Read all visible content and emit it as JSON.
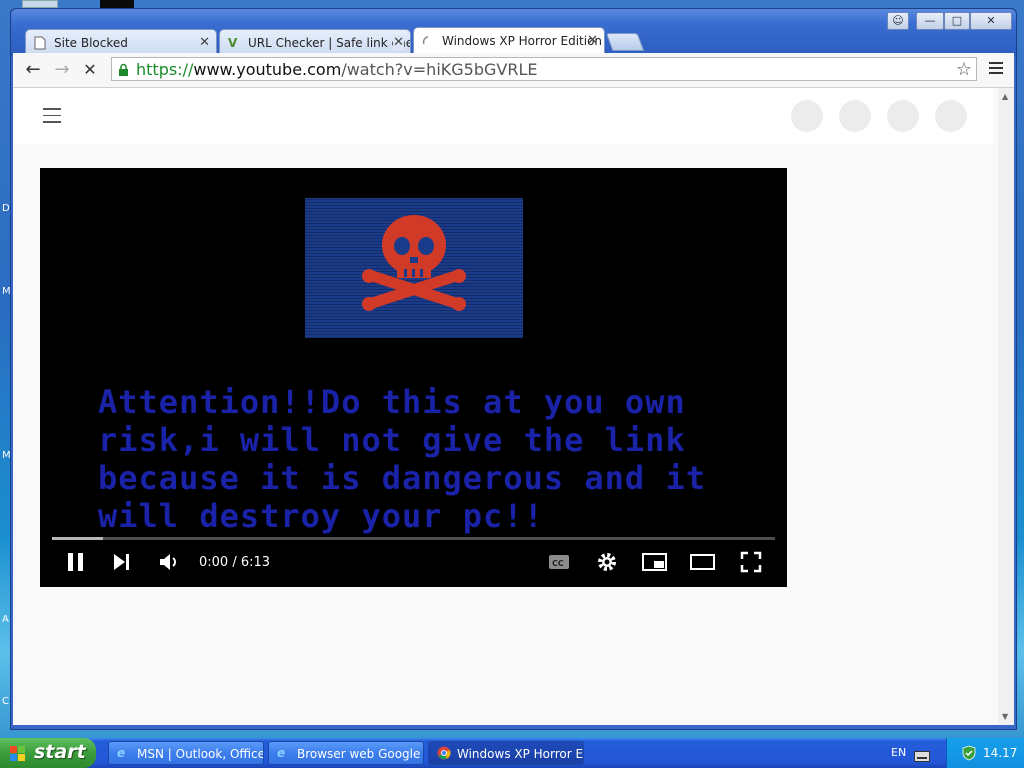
{
  "desktop": {
    "edge_letters": [
      "D",
      "M",
      "M",
      "A",
      "C"
    ]
  },
  "window": {
    "controls": {
      "user": "☺",
      "minimize": "—",
      "maximize": "□",
      "close": "✕"
    }
  },
  "tabs": [
    {
      "title": "Site Blocked",
      "icon": "page-icon",
      "active": false
    },
    {
      "title": "URL Checker | Safe link check",
      "icon": "v-logo-icon",
      "active": false
    },
    {
      "title": "Windows XP Horror Edition -",
      "icon": "loading-icon",
      "active": true
    }
  ],
  "toolbar": {
    "back": "←",
    "forward": "→",
    "stop": "✕",
    "url_scheme": "https://",
    "url_host": "www.youtube.com",
    "url_path": "/watch?v=hiKG5bGVRLE",
    "star": "☆"
  },
  "video": {
    "overlay_text": "Attention!!Do this at you own risk,i will not give the link because it is dangerous and it will destroy your pc!!",
    "time": "0:00 / 6:13",
    "progress_fraction": 0.07,
    "colors": {
      "flag": "#1a3a8a",
      "skull": "#d23a28",
      "text": "#1a22a8"
    }
  },
  "taskbar": {
    "start_label": "start",
    "tasks": [
      {
        "label": "MSN | Outlook, Office...",
        "icon": "ie-icon",
        "active": false
      },
      {
        "label": "Browser web Google ...",
        "icon": "ie-icon",
        "active": false
      },
      {
        "label": "Windows XP Horror E...",
        "icon": "chrome-icon",
        "active": true
      }
    ],
    "language": "EN",
    "clock": "14.17"
  }
}
